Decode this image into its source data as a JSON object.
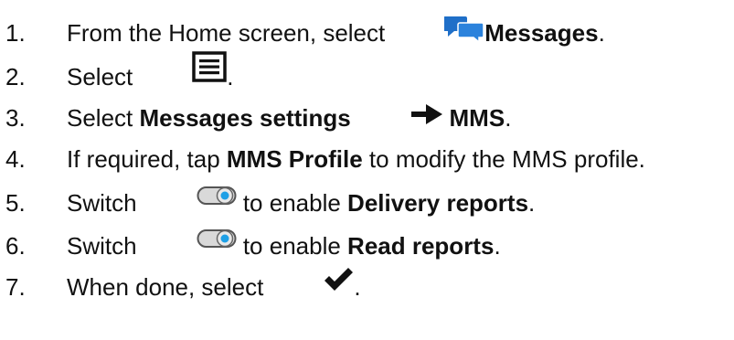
{
  "steps": [
    {
      "num": "1.",
      "pre": "From the Home screen, select ",
      "icon": "messages-icon",
      "bold": "Messages",
      "post": "."
    },
    {
      "num": "2.",
      "pre": "Select ",
      "icon": "menu-icon",
      "post": "."
    },
    {
      "num": "3.",
      "pre": "Select ",
      "bold1": "Messages settings",
      "icon": "right-arrow-icon",
      "bold2": "MMS",
      "post": "."
    },
    {
      "num": "4.",
      "pre": "If required, tap ",
      "bold": "MMS Profile",
      "post": " to modify the MMS profile."
    },
    {
      "num": "5.",
      "pre": "Switch ",
      "icon": "toggle-switch-icon",
      "mid": " to enable ",
      "bold": "Delivery reports",
      "post": "."
    },
    {
      "num": "6.",
      "pre": "Switch ",
      "icon": "toggle-switch-icon",
      "mid": " to enable ",
      "bold": "Read reports",
      "post": "."
    },
    {
      "num": "7.",
      "pre": "When done, select ",
      "icon": "checkmark-icon",
      "post": "."
    }
  ],
  "colors": {
    "text": "#111111",
    "messages_icon_back": "#1f6fc8",
    "messages_icon_front": "#2b82dc",
    "toggle_knob": "#1ea0e6"
  }
}
